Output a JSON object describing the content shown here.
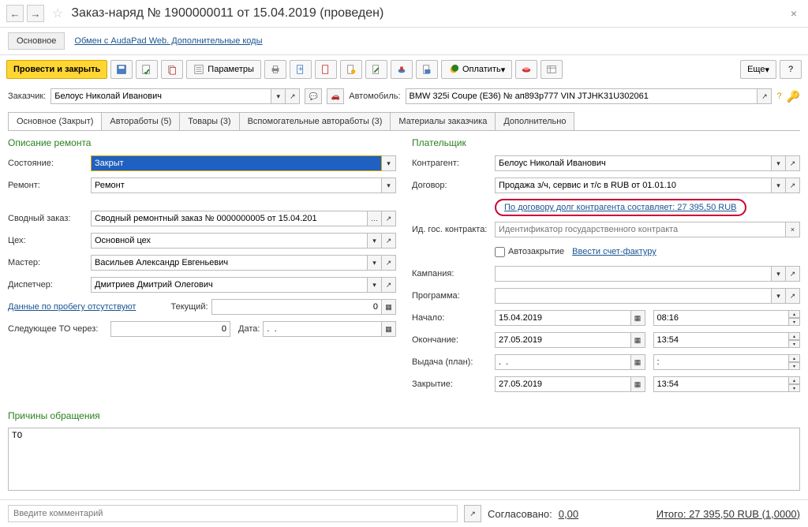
{
  "header": {
    "title": "Заказ-наряд № 1900000011 от 15.04.2019 (проведен)"
  },
  "subheader": {
    "main_tab": "Основное",
    "link": "Обмен с AudaPad Web. Дополнительные коды"
  },
  "toolbar": {
    "save_close": "Провести и закрыть",
    "params": "Параметры",
    "pay": "Оплатить",
    "more": "Еще"
  },
  "infobar": {
    "customer_label": "Заказчик:",
    "customer_value": "Белоус Николай Иванович",
    "auto_label": "Автомобиль:",
    "auto_value": "BMW 325i Coupe (E36) № ап893р777 VIN JTJHK31U302061"
  },
  "tabs": [
    "Основное (Закрыт)",
    "Авторaботы (5)",
    "Товары (3)",
    "Вспомогательные авторaботы (3)",
    "Материалы заказчика",
    "Дополнительно"
  ],
  "left": {
    "section": "Описание ремонта",
    "state_label": "Состояние:",
    "state_value": "Закрыт",
    "repair_label": "Ремонт:",
    "repair_value": "Ремонт",
    "summary_label": "Сводный заказ:",
    "summary_value": "Сводный ремонтный заказ № 0000000005 от 15.04.201",
    "shop_label": "Цех:",
    "shop_value": "Основной цех",
    "master_label": "Мастер:",
    "master_value": "Васильев Александр Евгеньевич",
    "dispatcher_label": "Диспетчер:",
    "dispatcher_value": "Дмитриев Дмитрий Олегович",
    "mileage_link": "Данные по пробегу отсутствуют",
    "current_label": "Текущий:",
    "current_value": "0",
    "next_to_label": "Следующее ТО через:",
    "next_to_value": "0",
    "date_label": "Дата:",
    "date_value": ".  ."
  },
  "right": {
    "section": "Плательщик",
    "counterparty_label": "Контрагент:",
    "counterparty_value": "Белоус Николай Иванович",
    "contract_label": "Договор:",
    "contract_value": "Продажа з/ч, сервис и т/с в RUB от 01.01.10",
    "debt_link": "По договору долг контрагента составляет: 27 395,50 RUB",
    "gov_label": "Ид. гос. контракта:",
    "gov_placeholder": "Идентификатор государственного контракта",
    "autoclose_label": "Автозакрытие",
    "invoice_link": "Ввести счет-фактуру",
    "campaign_label": "Кампания:",
    "program_label": "Программа:",
    "start_label": "Начало:",
    "start_date": "15.04.2019",
    "start_time": "08:16",
    "end_label": "Окончание:",
    "end_date": "27.05.2019",
    "end_time": "13:54",
    "issue_label": "Выдача (план):",
    "issue_date": ".  .",
    "issue_time": ":",
    "close_label": "Закрытие:",
    "close_date": "27.05.2019",
    "close_time": "13:54"
  },
  "reasons": {
    "title": "Причины обращения",
    "text": "ТО"
  },
  "footer": {
    "comment_placeholder": "Введите комментарий",
    "agreed_label": "Согласовано:",
    "agreed_value": "0,00",
    "total_label": "Итого:",
    "total_value": "27 395,50 RUB (1,0000)"
  }
}
